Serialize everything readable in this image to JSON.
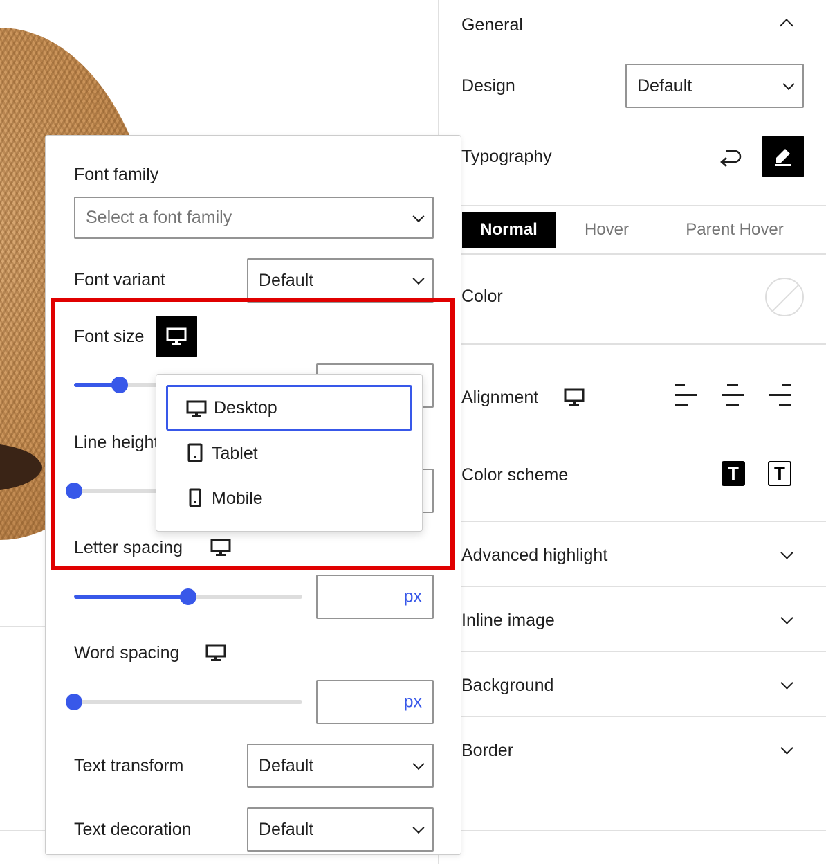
{
  "sidebar": {
    "general_title": "General",
    "design_label": "Design",
    "design_value": "Default",
    "typography_label": "Typography",
    "tabs": [
      "Normal",
      "Hover",
      "Parent Hover"
    ],
    "color_label": "Color",
    "alignment_label": "Alignment",
    "color_scheme_label": "Color scheme",
    "color_scheme_icons": [
      "T",
      "T"
    ],
    "sections": [
      "Advanced highlight",
      "Inline image",
      "Background",
      "Border"
    ]
  },
  "popover": {
    "font_family_label": "Font family",
    "font_family_placeholder": "Select a font family",
    "font_variant_label": "Font variant",
    "font_variant_value": "Default",
    "font_size_label": "Font size",
    "line_height_label": "Line height",
    "letter_spacing_label": "Letter spacing",
    "letter_spacing_unit": "px",
    "word_spacing_label": "Word spacing",
    "word_spacing_unit": "px",
    "text_transform_label": "Text transform",
    "text_transform_value": "Default",
    "text_decoration_label": "Text decoration",
    "text_decoration_value": "Default",
    "sliders": {
      "font_size": 0.2,
      "line_height": 0.0,
      "letter_spacing": 0.5,
      "word_spacing": 0.0
    }
  },
  "device_menu": {
    "items": [
      "Desktop",
      "Tablet",
      "Mobile"
    ],
    "selected": "Desktop"
  },
  "colors": {
    "accent": "#3858e9",
    "highlight": "#e00000"
  }
}
